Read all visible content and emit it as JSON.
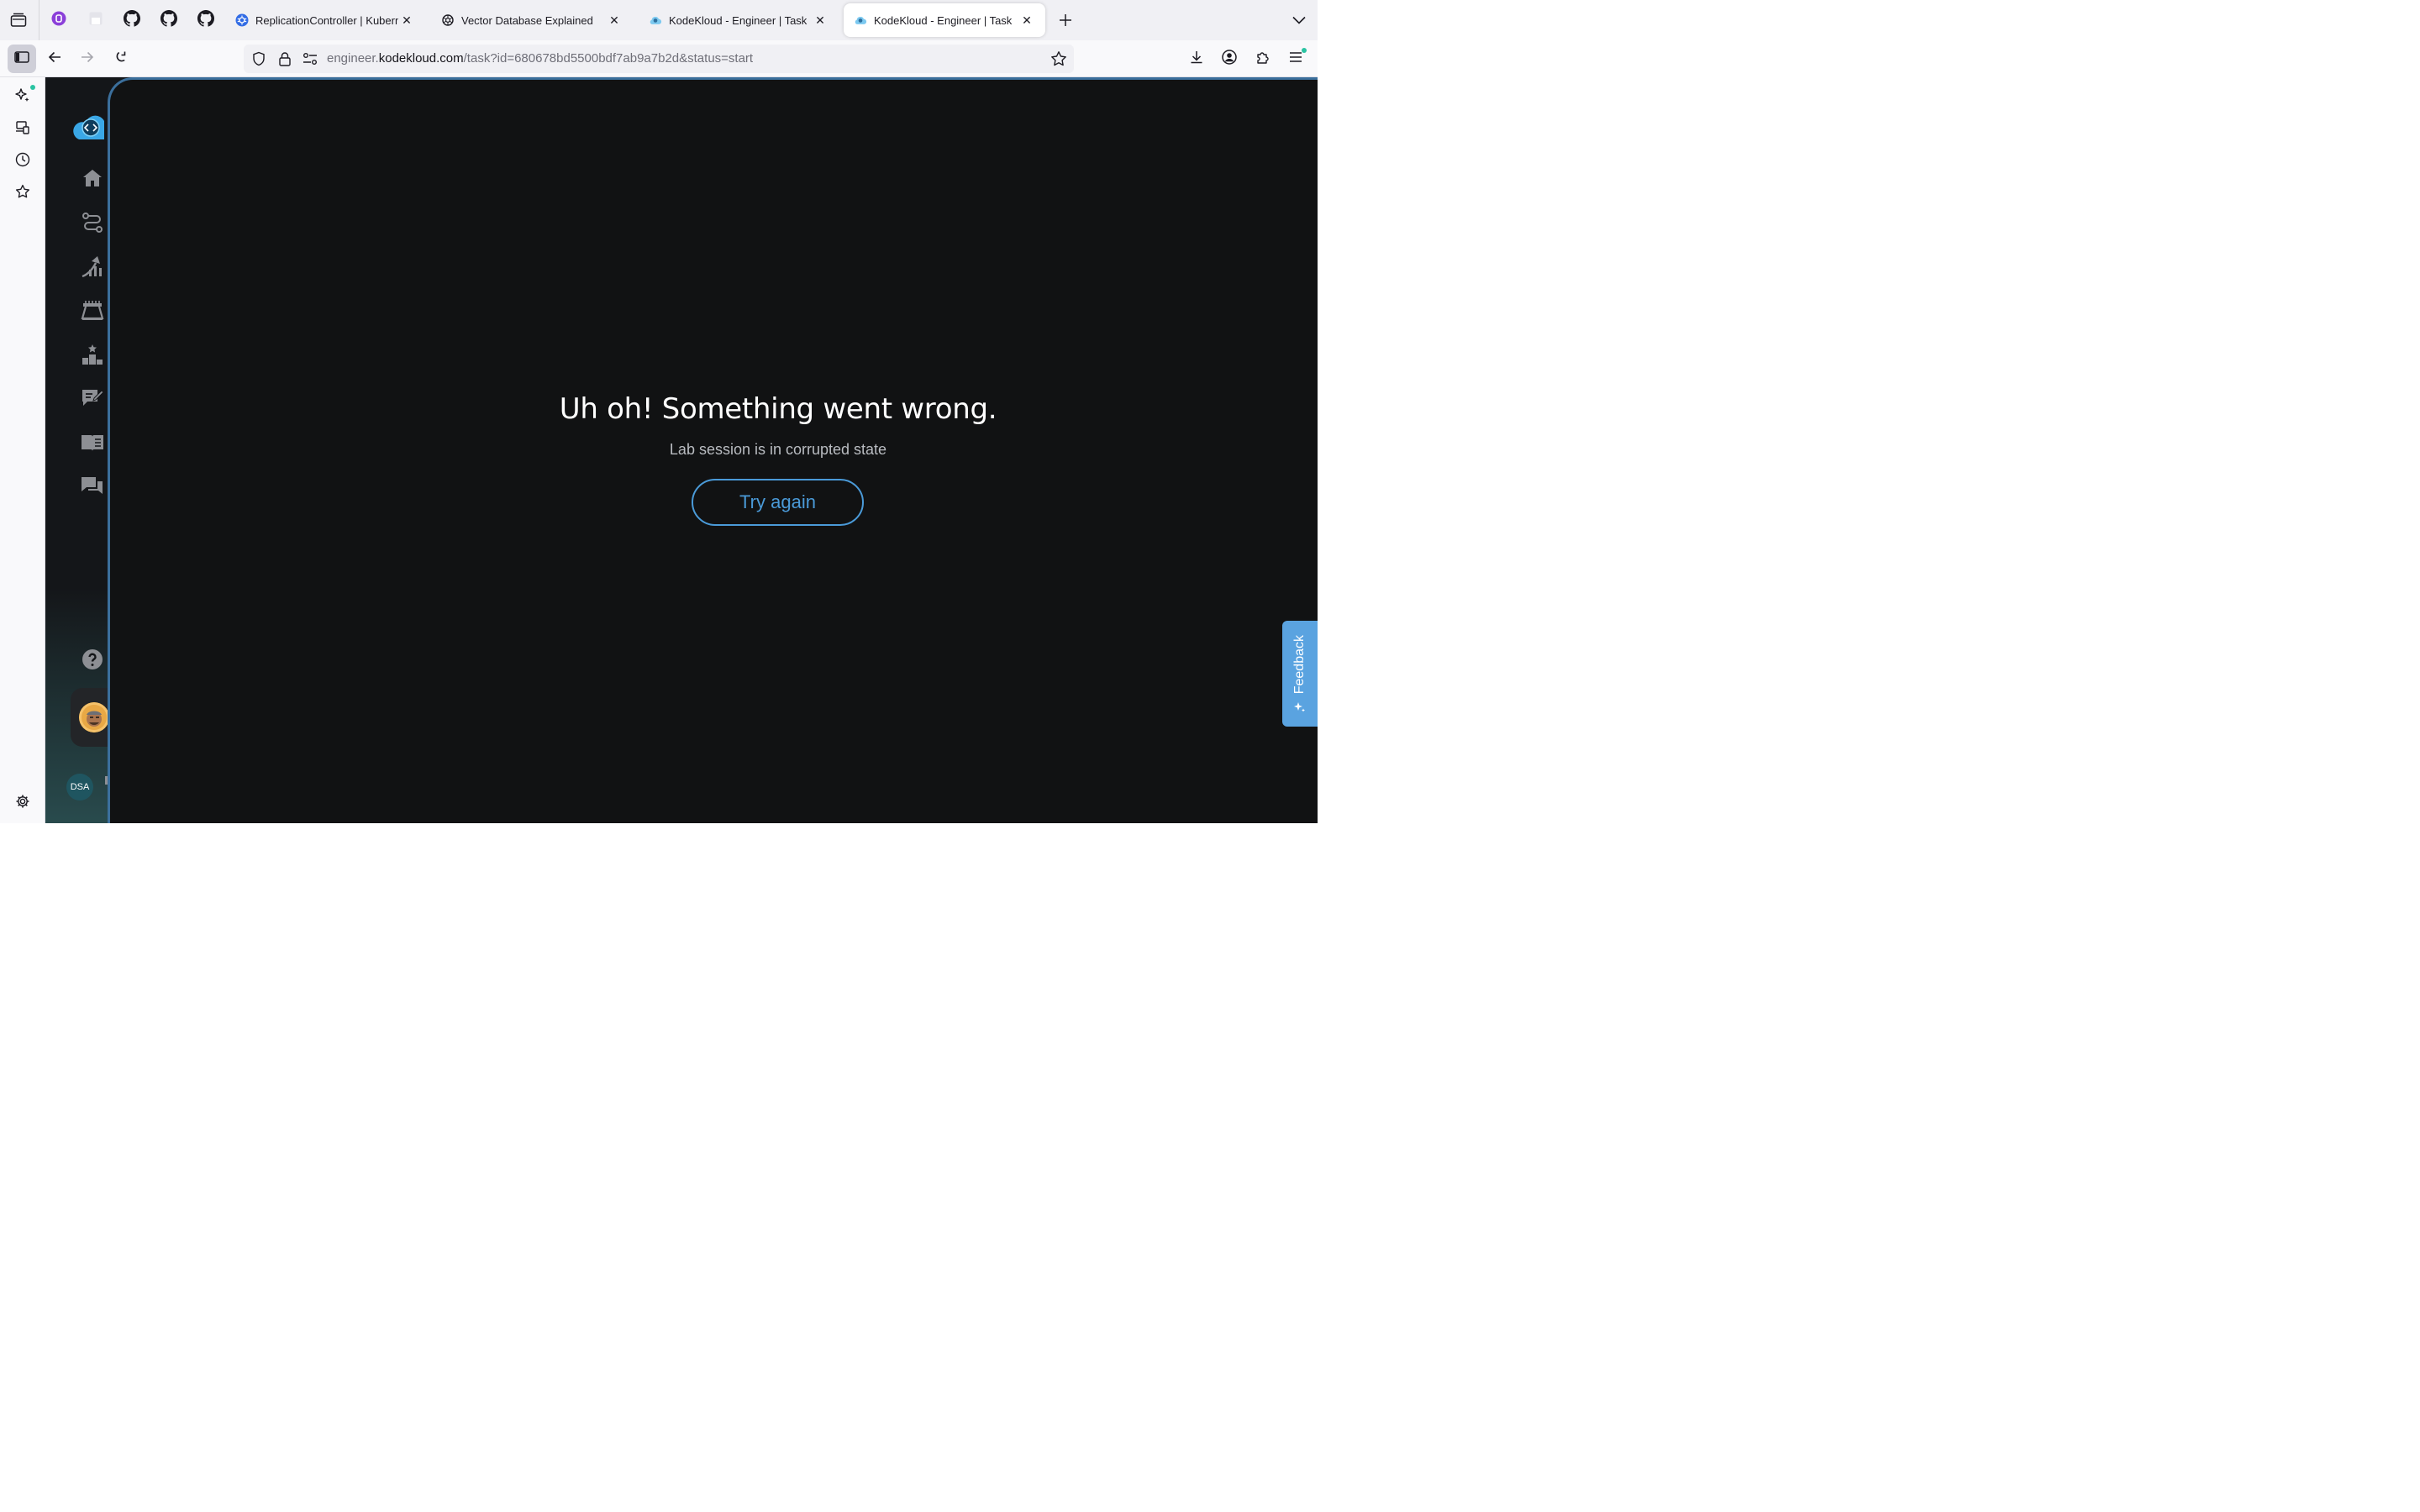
{
  "browser": {
    "tabs": [
      {
        "title": "ReplicationController | Kubernet",
        "favicon": "kubernetes-icon",
        "active": false
      },
      {
        "title": "Vector Database Explained",
        "favicon": "openai-icon",
        "active": false
      },
      {
        "title": "KodeKloud - Engineer | Task",
        "favicon": "kodekloud-cloud-icon",
        "active": false
      },
      {
        "title": "KodeKloud - Engineer | Task",
        "favicon": "kodekloud-cloud-icon",
        "active": true
      }
    ],
    "pinned_tabs": [
      "extension-icon",
      "blank-page-icon",
      "github-icon",
      "github-icon",
      "github-icon"
    ],
    "url": {
      "prefix": "engineer.",
      "domain": "kodekloud.com",
      "path": "/task?id=680678bd5500bdf7ab9a7b2d&status=start"
    }
  },
  "app": {
    "rail_items": [
      "home-icon",
      "route-icon",
      "progress-icon",
      "tasks-icon",
      "leaderboard-icon",
      "notes-icon",
      "docs-icon",
      "forum-icon"
    ],
    "help_icon": "help-icon",
    "user_initials": "DSA"
  },
  "error": {
    "title": "Uh oh! Something went wrong.",
    "subtitle": "Lab session is in corrupted state",
    "button_label": "Try again"
  },
  "feedback": {
    "label": "Feedback"
  },
  "colors": {
    "accent": "#4a9ad8",
    "panel_border": "#3b6f9c",
    "feedback_bg": "#5aa3e0",
    "page_bg": "#111213"
  }
}
